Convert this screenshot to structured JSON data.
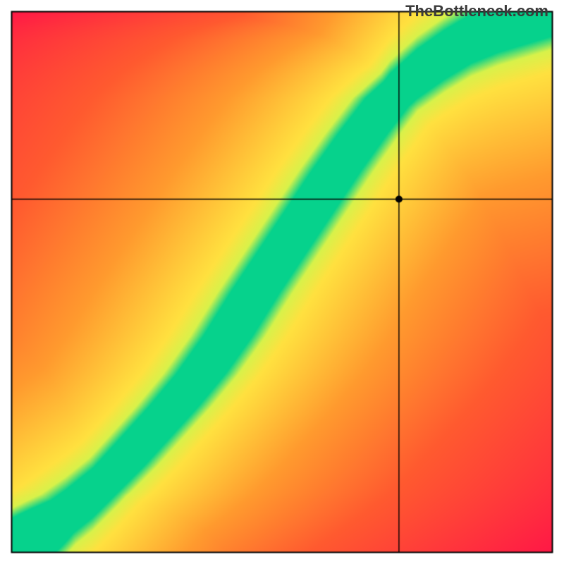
{
  "watermark": "TheBottleneck.com",
  "plot": {
    "outer_margin": 16,
    "border_color": "#000000",
    "crosshair": {
      "x_frac": 0.716,
      "y_frac": 0.653
    },
    "marker_radius": 5,
    "optimal_curve": {
      "points": [
        [
          0.0,
          0.0
        ],
        [
          0.05,
          0.035
        ],
        [
          0.1,
          0.07
        ],
        [
          0.15,
          0.11
        ],
        [
          0.2,
          0.16
        ],
        [
          0.25,
          0.215
        ],
        [
          0.3,
          0.27
        ],
        [
          0.35,
          0.33
        ],
        [
          0.4,
          0.4
        ],
        [
          0.45,
          0.48
        ],
        [
          0.5,
          0.555
        ],
        [
          0.55,
          0.63
        ],
        [
          0.6,
          0.705
        ],
        [
          0.65,
          0.775
        ],
        [
          0.7,
          0.84
        ],
        [
          0.75,
          0.885
        ],
        [
          0.8,
          0.92
        ],
        [
          0.85,
          0.95
        ],
        [
          0.9,
          0.97
        ],
        [
          0.95,
          0.985
        ],
        [
          1.0,
          1.0
        ]
      ]
    },
    "band_half_width": 0.045,
    "colors": {
      "green": "#06d28c",
      "lime": "#d8f24a",
      "yellow": "#ffe13f",
      "orange": "#ff9a2e",
      "redor": "#ff5a2f",
      "red": "#ff1846"
    }
  },
  "chart_data": {
    "type": "heatmap",
    "title": "",
    "xlabel": "",
    "ylabel": "",
    "x_range": [
      0,
      1
    ],
    "y_range": [
      0,
      1
    ],
    "description": "Bottleneck heatmap. Green diagonal band = balanced CPU/GPU pairing; moving away through yellow → orange → red indicates increasing bottleneck. Black crosshair + dot mark the user's selected components.",
    "optimal_curve_xy": [
      [
        0.0,
        0.0
      ],
      [
        0.05,
        0.035
      ],
      [
        0.1,
        0.07
      ],
      [
        0.15,
        0.11
      ],
      [
        0.2,
        0.16
      ],
      [
        0.25,
        0.215
      ],
      [
        0.3,
        0.27
      ],
      [
        0.35,
        0.33
      ],
      [
        0.4,
        0.4
      ],
      [
        0.45,
        0.48
      ],
      [
        0.5,
        0.555
      ],
      [
        0.55,
        0.63
      ],
      [
        0.6,
        0.705
      ],
      [
        0.65,
        0.775
      ],
      [
        0.7,
        0.84
      ],
      [
        0.75,
        0.885
      ],
      [
        0.8,
        0.92
      ],
      [
        0.85,
        0.95
      ],
      [
        0.9,
        0.97
      ],
      [
        0.95,
        0.985
      ],
      [
        1.0,
        1.0
      ]
    ],
    "selected_point": {
      "x": 0.716,
      "y": 0.653
    },
    "color_stops_by_distance": [
      {
        "d": 0.0,
        "color": "#06d28c"
      },
      {
        "d": 0.045,
        "color": "#06d28c"
      },
      {
        "d": 0.07,
        "color": "#d8f24a"
      },
      {
        "d": 0.11,
        "color": "#ffe13f"
      },
      {
        "d": 0.3,
        "color": "#ff9a2e"
      },
      {
        "d": 0.55,
        "color": "#ff5a2f"
      },
      {
        "d": 1.0,
        "color": "#ff1846"
      }
    ]
  }
}
